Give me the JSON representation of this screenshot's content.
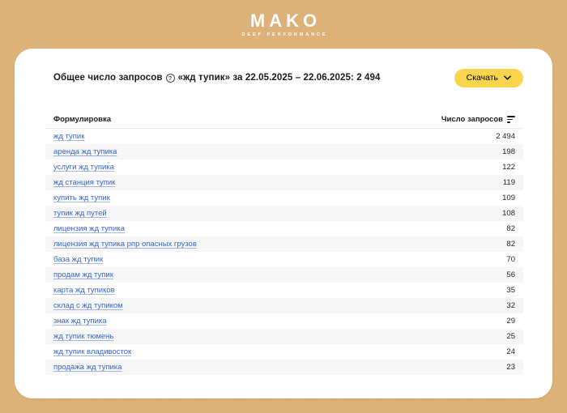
{
  "page": {
    "background_color": "#deb278",
    "card_color": "#ffffff"
  },
  "header": {
    "logo_title": "MAKO",
    "logo_subtitle": "DEEP PERFORMANCE"
  },
  "summary": {
    "title_prefix": "Общее число запросов",
    "help_icon": "?",
    "title_suffix": "«жд тупик» за 22.05.2025 – 22.06.2025: 2 494",
    "total_count": "2 494",
    "query": "жд тупик",
    "period_start": "22.05.2025",
    "period_end": "22.06.2025"
  },
  "toolbar": {
    "download_label": "Скачать",
    "download_icon": "chevron-down"
  },
  "table": {
    "columns": {
      "phrase": "Формулировка",
      "count": "Число запросов"
    },
    "sort_icon": "sort-descending",
    "rows": [
      {
        "phrase": "жд тупик",
        "count": "2 494"
      },
      {
        "phrase": "аренда жд тупика",
        "count": "198"
      },
      {
        "phrase": "услуги жд тупика",
        "count": "122"
      },
      {
        "phrase": "жд станция тупик",
        "count": "119"
      },
      {
        "phrase": "купить жд тупик",
        "count": "109"
      },
      {
        "phrase": "тупик жд путей",
        "count": "108"
      },
      {
        "phrase": "лицензия жд тупика",
        "count": "82"
      },
      {
        "phrase": "лицензия жд тупика рпр опасных грузов",
        "count": "82"
      },
      {
        "phrase": "база жд тупик",
        "count": "70"
      },
      {
        "phrase": "продам жд тупик",
        "count": "56"
      },
      {
        "phrase": "карта жд тупиков",
        "count": "35"
      },
      {
        "phrase": "склад с жд тупиком",
        "count": "32"
      },
      {
        "phrase": "знак жд тупика",
        "count": "29"
      },
      {
        "phrase": "жд тупик тюмень",
        "count": "25"
      },
      {
        "phrase": "жд тупик владивосток",
        "count": "24"
      },
      {
        "phrase": "продажа жд тупика",
        "count": "23"
      }
    ]
  },
  "colors": {
    "accent_yellow": "#f9d54d",
    "link_blue": "#3366cc",
    "stripe_gray": "#f6f6f6",
    "background_tan": "#deb278"
  }
}
